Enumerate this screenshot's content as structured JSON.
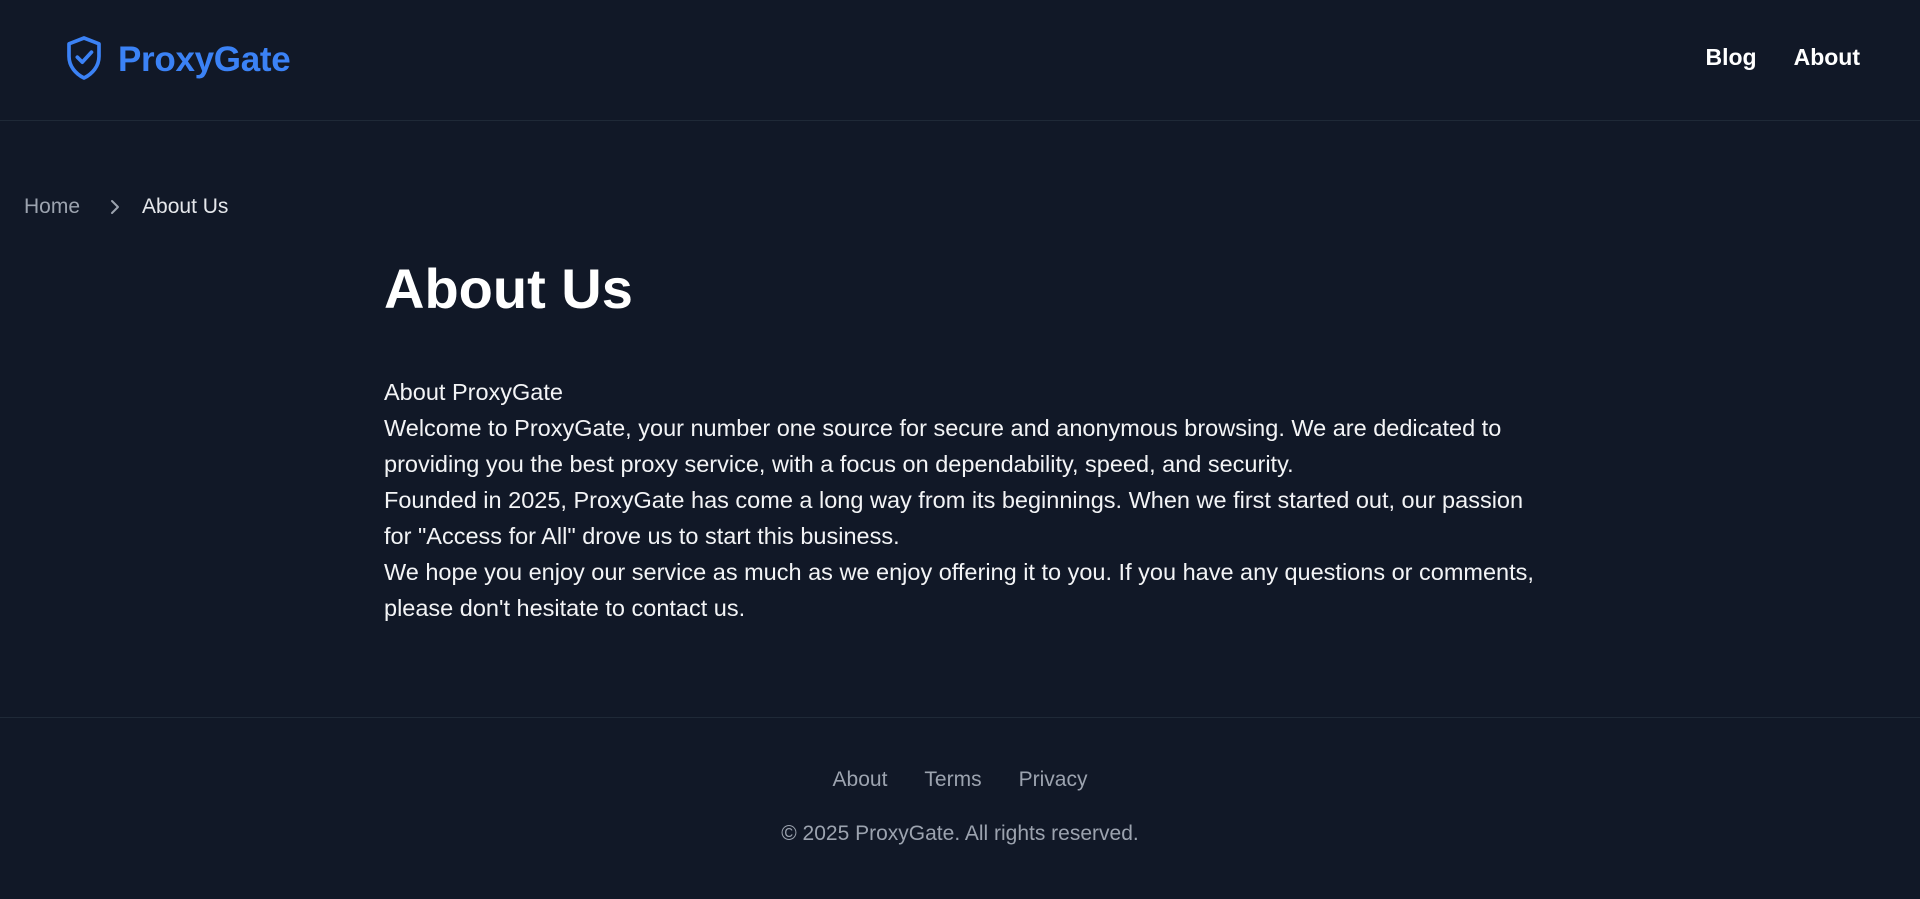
{
  "header": {
    "brand": "ProxyGate",
    "brand_color": "#3b82f6",
    "logo_icon": "shield-check-icon",
    "nav": [
      {
        "label": "Blog"
      },
      {
        "label": "About"
      }
    ]
  },
  "breadcrumb": {
    "home": "Home",
    "separator_icon": "chevron-right-icon",
    "current": "About Us"
  },
  "main": {
    "title": "About Us",
    "paragraphs": [
      "About ProxyGate",
      "Welcome to ProxyGate, your number one source for secure and anonymous browsing. We are dedicated to providing you the best proxy service, with a focus on dependability, speed, and security.",
      "Founded in 2025, ProxyGate has come a long way from its beginnings. When we first started out, our passion for \"Access for All\" drove us to start this business.",
      "We hope you enjoy our service as much as we enjoy offering it to you. If you have any questions or comments, please don't hesitate to contact us."
    ]
  },
  "footer": {
    "links": [
      {
        "label": "About"
      },
      {
        "label": "Terms"
      },
      {
        "label": "Privacy"
      }
    ],
    "copyright": "© 2025 ProxyGate. All rights reserved."
  },
  "colors": {
    "background": "#111827",
    "accent": "#3b82f6",
    "muted_text": "#9ca3af"
  }
}
